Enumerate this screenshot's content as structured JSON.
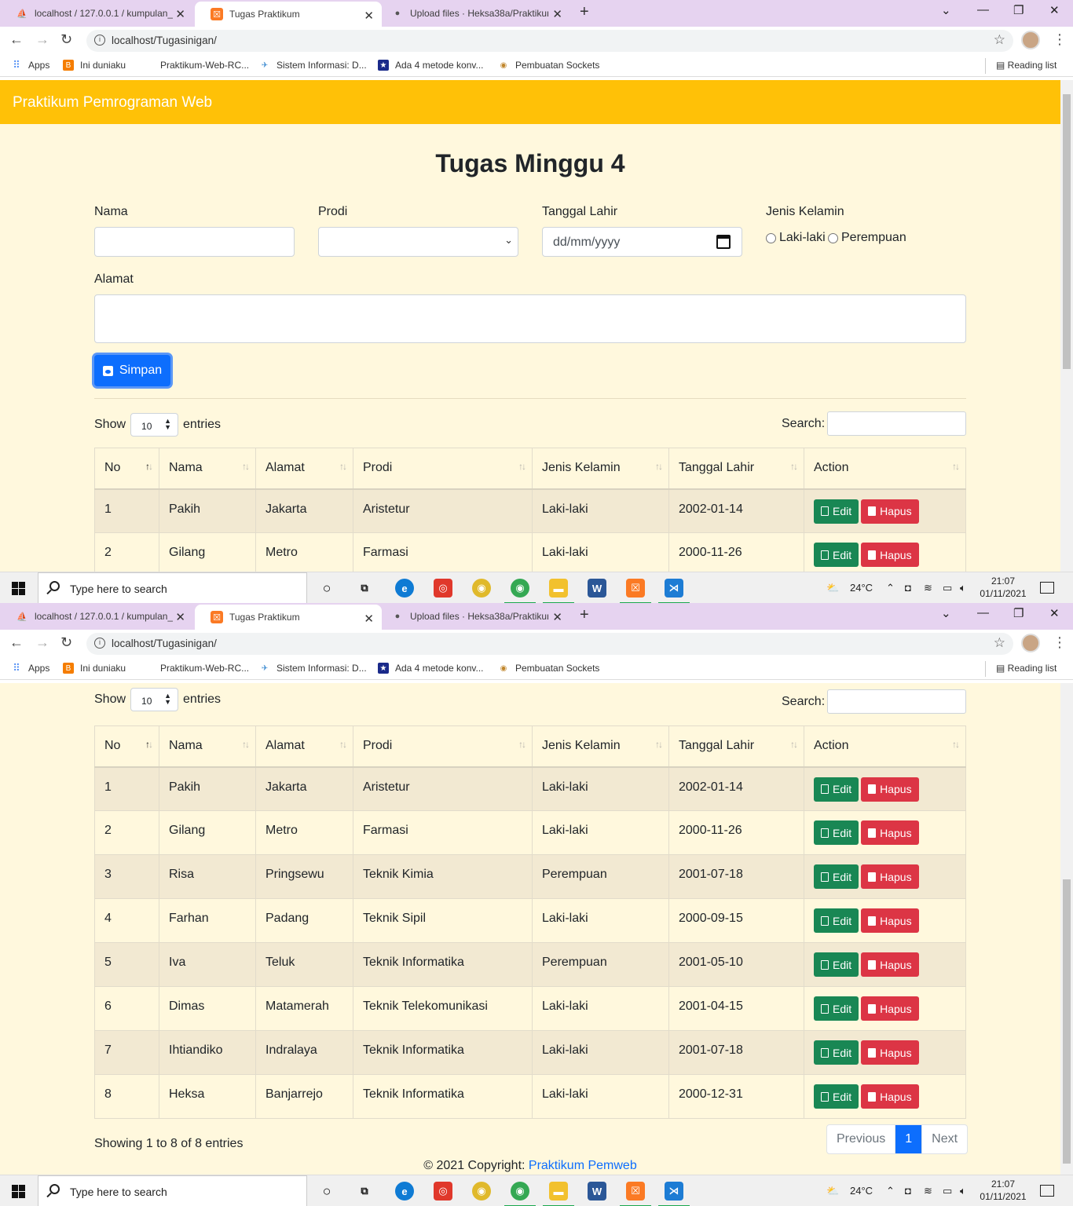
{
  "browser": {
    "tabs": [
      {
        "title": "localhost / 127.0.0.1 / kumpulan_",
        "icon": "phpmyadmin-icon"
      },
      {
        "title": "Tugas Praktikum",
        "icon": "xampp-icon"
      },
      {
        "title": "Upload files · Heksa38a/Praktikum",
        "icon": "github-icon"
      }
    ],
    "url": "localhost/Tugasinigan/",
    "bookmarks": [
      {
        "label": "Apps",
        "icon": "apps-grid-icon"
      },
      {
        "label": "Ini duniaku",
        "icon": "blogger-icon"
      },
      {
        "label": "Praktikum-Web-RC...",
        "icon": "page-icon"
      },
      {
        "label": "Sistem Informasi: D...",
        "icon": "wind-icon"
      },
      {
        "label": "Ada 4 metode konv...",
        "icon": "star-badge-icon"
      },
      {
        "label": "Pembuatan Sockets",
        "icon": "eye-icon"
      }
    ],
    "reading_list": "Reading list"
  },
  "page": {
    "brand": "Praktikum Pemrograman Web",
    "title": "Tugas Minggu 4",
    "form": {
      "nama_label": "Nama",
      "prodi_label": "Prodi",
      "tanggal_label": "Tanggal Lahir",
      "tanggal_placeholder": "dd/mm/yyyy",
      "jk_label": "Jenis Kelamin",
      "jk_options": [
        "Laki-laki",
        "Perempuan"
      ],
      "alamat_label": "Alamat",
      "submit_label": "Simpan"
    },
    "table": {
      "show_label": "Show",
      "entries_label": "entries",
      "length_value": "10",
      "search_label": "Search:",
      "columns": [
        "No",
        "Nama",
        "Alamat",
        "Prodi",
        "Jenis Kelamin",
        "Tanggal Lahir",
        "Action"
      ],
      "rows": [
        {
          "no": "1",
          "nama": "Pakih",
          "alamat": "Jakarta",
          "prodi": "Aristetur",
          "jk": "Laki-laki",
          "tgl": "2002-01-14"
        },
        {
          "no": "2",
          "nama": "Gilang",
          "alamat": "Metro",
          "prodi": "Farmasi",
          "jk": "Laki-laki",
          "tgl": "2000-11-26"
        },
        {
          "no": "3",
          "nama": "Risa",
          "alamat": "Pringsewu",
          "prodi": "Teknik Kimia",
          "jk": "Perempuan",
          "tgl": "2001-07-18"
        },
        {
          "no": "4",
          "nama": "Farhan",
          "alamat": "Padang",
          "prodi": "Teknik Sipil",
          "jk": "Laki-laki",
          "tgl": "2000-09-15"
        },
        {
          "no": "5",
          "nama": "Iva",
          "alamat": "Teluk",
          "prodi": "Teknik Informatika",
          "jk": "Perempuan",
          "tgl": "2001-05-10"
        },
        {
          "no": "6",
          "nama": "Dimas",
          "alamat": "Matamerah",
          "prodi": "Teknik Telekomunikasi",
          "jk": "Laki-laki",
          "tgl": "2001-04-15"
        },
        {
          "no": "7",
          "nama": "Ihtiandiko",
          "alamat": "Indralaya",
          "prodi": "Teknik Informatika",
          "jk": "Laki-laki",
          "tgl": "2001-07-18"
        },
        {
          "no": "8",
          "nama": "Heksa",
          "alamat": "Banjarrejo",
          "prodi": "Teknik Informatika",
          "jk": "Laki-laki",
          "tgl": "2000-12-31"
        }
      ],
      "edit_label": "Edit",
      "hapus_label": "Hapus",
      "info": "Showing 1 to 8 of 8 entries",
      "pager": {
        "prev": "Previous",
        "current": "1",
        "next": "Next"
      }
    },
    "footer": {
      "prefix": "© 2021 Copyright: ",
      "link": "Praktikum Pemweb"
    }
  },
  "taskbar": {
    "search_placeholder": "Type here to search",
    "apps": [
      "task-view-icon",
      "edge-icon",
      "app-icon",
      "chrome-icon",
      "chrome-profile-icon",
      "file-explorer-icon",
      "word-icon",
      "xampp-icon",
      "vscode-icon"
    ],
    "weather": "24°C",
    "time": "21:07",
    "date": "01/11/2021"
  },
  "colors": {
    "navbar": "#ffc107",
    "page_bg": "#fff8dd",
    "primary": "#0d6efd",
    "success": "#198754",
    "danger": "#dc3545",
    "tabstrip": "#e6d3f0"
  }
}
